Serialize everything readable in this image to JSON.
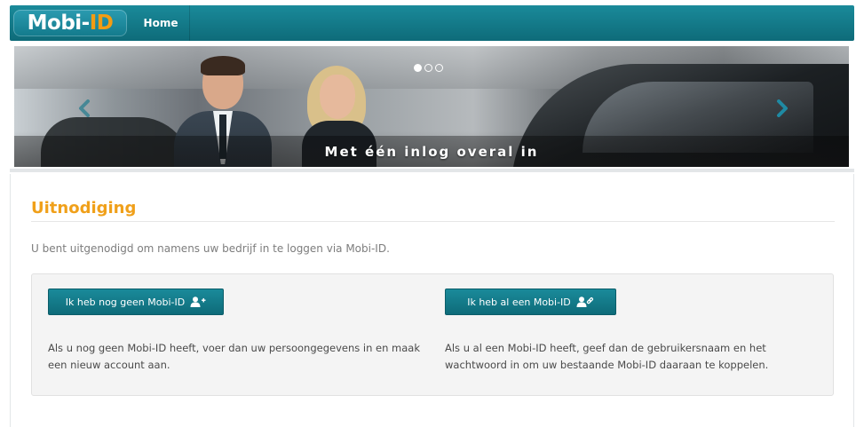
{
  "navbar": {
    "logo": {
      "prefix": "Mobi-",
      "suffix": "ID"
    },
    "home_label": "Home"
  },
  "carousel": {
    "caption": "Met één inlog overal in",
    "slide_count": 3,
    "active_slide": 1
  },
  "invitation": {
    "title": "Uitnodiging",
    "intro": "U bent uitgenodigd om namens uw bedrijf in te loggen via Mobi-ID.",
    "options": {
      "new": {
        "button_label": "Ik heb nog geen Mobi-ID",
        "icon": "user-add-icon",
        "description": "Als u nog geen Mobi-ID heeft, voer dan uw persoongegevens in en maak een nieuw account aan."
      },
      "existing": {
        "button_label": "Ik heb al een Mobi-ID",
        "icon": "user-link-icon",
        "description": "Als u al een Mobi-ID heeft, geef dan de gebruikersnaam en het wachtwoord in om uw bestaande Mobi-ID daaraan te koppelen."
      }
    }
  },
  "colors": {
    "brand_teal": "#0e6b79",
    "accent_orange": "#f0a01a",
    "logo_id_orange": "#f39c12"
  }
}
